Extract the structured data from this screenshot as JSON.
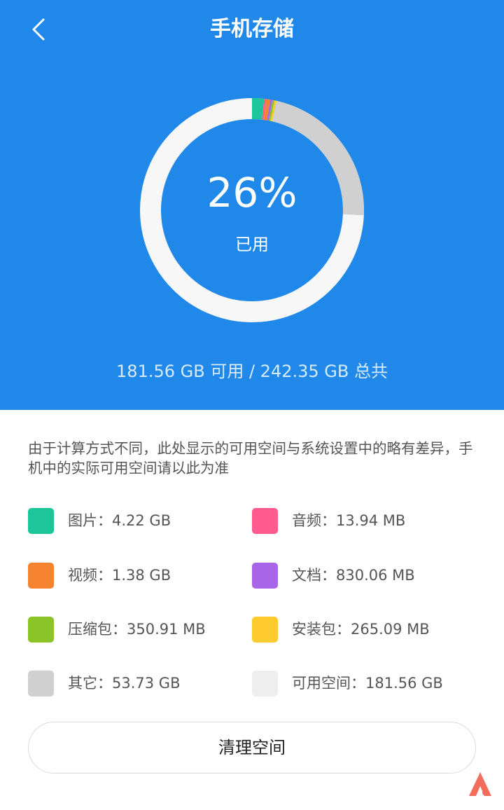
{
  "header": {
    "title": "手机存储",
    "back_icon": "chevron-left-icon",
    "background": "#1f88e8"
  },
  "storage": {
    "percent_label": "26%",
    "used_label": "已用",
    "used_fraction": 0.26,
    "summary": "181.56 GB 可用 / 242.35 GB 总共"
  },
  "note": "由于计算方式不同，此处显示的可用空间与系统设置中的略有差异，手机中的实际可用空间请以此为准",
  "legend": {
    "items": [
      {
        "label": "图片：4.22 GB",
        "color": "#1dc69a",
        "gb": 4.22
      },
      {
        "label": "音频：13.94 MB",
        "color": "#ff5b8f",
        "gb": 0.0136
      },
      {
        "label": "视频：1.38 GB",
        "color": "#f5822f",
        "gb": 1.38
      },
      {
        "label": "文档：830.06 MB",
        "color": "#a965e8",
        "gb": 0.81
      },
      {
        "label": "压缩包：350.91 MB",
        "color": "#8bc426",
        "gb": 0.343
      },
      {
        "label": "安装包：265.09 MB",
        "color": "#fecb2e",
        "gb": 0.259
      },
      {
        "label": "其它：53.73 GB",
        "color": "#d0d0d0",
        "gb": 53.73
      },
      {
        "label": "可用空间：181.56 GB",
        "color": "#eeeeee",
        "gb": 181.56
      }
    ]
  },
  "ring": {
    "order": [
      0,
      1,
      2,
      3,
      4,
      5,
      6
    ],
    "free_color": "#f7f7f7"
  },
  "actions": {
    "clean_label": "清理空间"
  },
  "watermark": {
    "icon": "brand-logo-icon",
    "color": "#f36d5d"
  }
}
